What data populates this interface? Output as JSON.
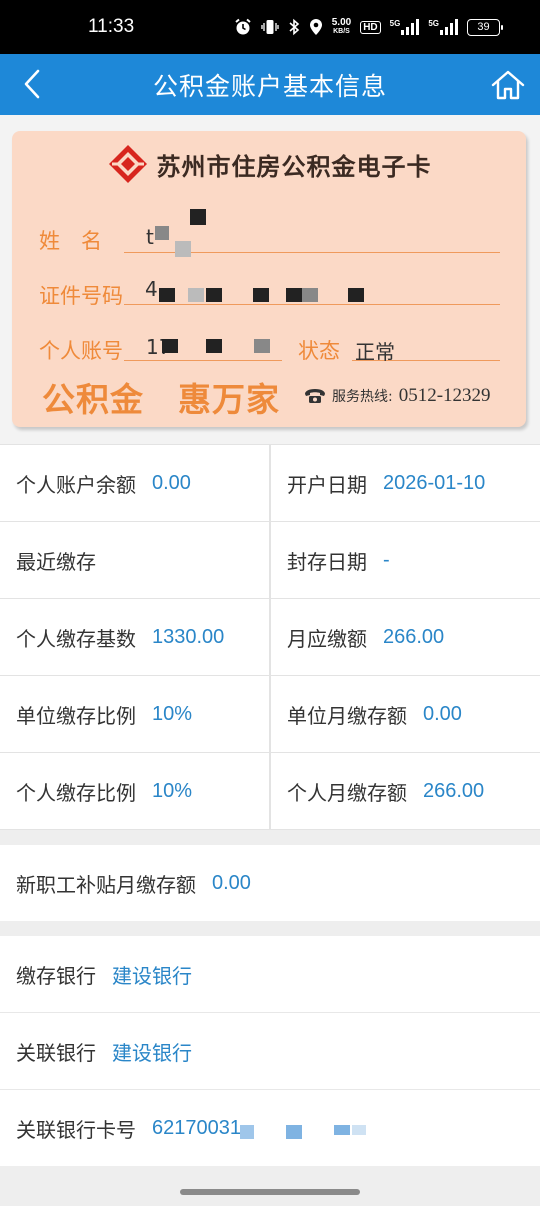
{
  "status_bar": {
    "time": "11:33",
    "net_speed_value": "5.00",
    "net_speed_unit": "KB/S",
    "hd": "HD",
    "sim1_tag": "5G",
    "sim2_tag": "5G",
    "battery": "39"
  },
  "header": {
    "title": "公积金账户基本信息"
  },
  "card": {
    "title": "苏州市住房公积金电子卡",
    "name_label": "姓　名",
    "name_value": "t",
    "id_label": "证件号码",
    "id_value": "4",
    "account_label": "个人账号",
    "account_value": "17",
    "status_label": "状态",
    "status_value": "正常",
    "slogan": "公积金　惠万家",
    "hotline_label": "服务热线:",
    "hotline_number": "0512-12329"
  },
  "info_grid": [
    {
      "label": "个人账户余额",
      "value": "0.00"
    },
    {
      "label": "开户日期",
      "value": "2026-01-10"
    },
    {
      "label": "最近缴存",
      "value": ""
    },
    {
      "label": "封存日期",
      "value": "-"
    },
    {
      "label": "个人缴存基数",
      "value": "1330.00"
    },
    {
      "label": "月应缴额",
      "value": "266.00"
    },
    {
      "label": "单位缴存比例",
      "value": "10%"
    },
    {
      "label": "单位月缴存额",
      "value": "0.00"
    },
    {
      "label": "个人缴存比例",
      "value": "10%"
    },
    {
      "label": "个人月缴存额",
      "value": "266.00"
    }
  ],
  "subsidy": {
    "label": "新职工补贴月缴存额",
    "value": "0.00"
  },
  "bank": {
    "deposit_bank_label": "缴存银行",
    "deposit_bank_value": "建设银行",
    "linked_bank_label": "关联银行",
    "linked_bank_value": "建设银行",
    "linked_card_label": "关联银行卡号",
    "linked_card_value": "62170031"
  },
  "colors": {
    "header_blue": "#1e88d8",
    "value_blue": "#2a86c8",
    "card_bg": "#fbd9c6",
    "card_orange": "#ee8a3b"
  }
}
